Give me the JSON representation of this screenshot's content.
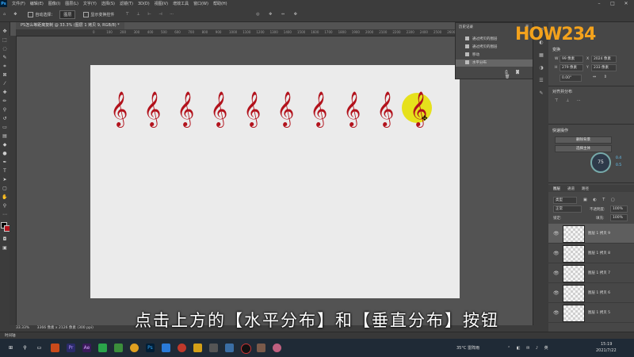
{
  "menu": {
    "logo": "Ps",
    "items": [
      "文件(F)",
      "编辑(E)",
      "图像(I)",
      "图层(L)",
      "文字(Y)",
      "选择(S)",
      "滤镜(T)",
      "3D(D)",
      "视图(V)",
      "增效工具",
      "窗口(W)",
      "帮助(H)"
    ]
  },
  "options": {
    "auto_select_label": "自动选择：",
    "auto_select_value": "图层",
    "show_transform_label": "显示变换控件"
  },
  "document": {
    "tab_title": "PS怎么等距离复制 @ 33.3% (图层 1 拷贝 9, RGB/8) *",
    "ruler_ticks": [
      "0",
      "100",
      "200",
      "300",
      "400",
      "500",
      "600",
      "700",
      "800",
      "900",
      "1000",
      "1100",
      "1200",
      "1300",
      "1400",
      "1500",
      "1600",
      "1700",
      "1800",
      "1900",
      "2000",
      "2100",
      "2200",
      "2300",
      "2400",
      "2500",
      "2600",
      "2700",
      "2800"
    ],
    "clef_symbol": "𝄞"
  },
  "history": {
    "title": "历史记录",
    "items": [
      "通过拷贝的图层",
      "通过拷贝的图层",
      "移动",
      "水平分布"
    ]
  },
  "properties": {
    "transform_title": "变换",
    "w_label": "W",
    "w_value": "99 像素",
    "x_label": "X",
    "x_value": "2024 像素",
    "h_label": "H",
    "h_value": "279 像素",
    "y_label": "Y",
    "y_value": "233 像素",
    "angle_value": "0.00°",
    "align_title": "对齐并分布",
    "quick_title": "快速操作",
    "btn_remove_bg": "删除背景",
    "btn_select_subject": "选择主体"
  },
  "zoom_widget": {
    "percent": "75",
    "up": "0.4",
    "down": "0.5"
  },
  "layers": {
    "tabs": [
      "图层",
      "通道",
      "路径"
    ],
    "filter_label": "类型",
    "blend_mode": "正常",
    "opacity_label": "不透明度:",
    "opacity_value": "100%",
    "lock_label": "锁定:",
    "fill_label": "填充:",
    "fill_value": "100%",
    "rows": [
      "图层 1 拷贝 9",
      "图层 1 拷贝 8",
      "图层 1 拷贝 7",
      "图层 1 拷贝 6",
      "图层 1 拷贝 5"
    ]
  },
  "status": {
    "zoom": "33.33%",
    "doc_info": "3366 像素 x 2126 像素 (300 ppi)"
  },
  "timeline_label": "时间轴",
  "caption": "点击上方的【水平分布】和【垂直分布】按钮",
  "watermark": "HOW234",
  "taskbar": {
    "weather": "35°C 雷阵雨",
    "time": "15:19",
    "date": "2021/7/22"
  }
}
